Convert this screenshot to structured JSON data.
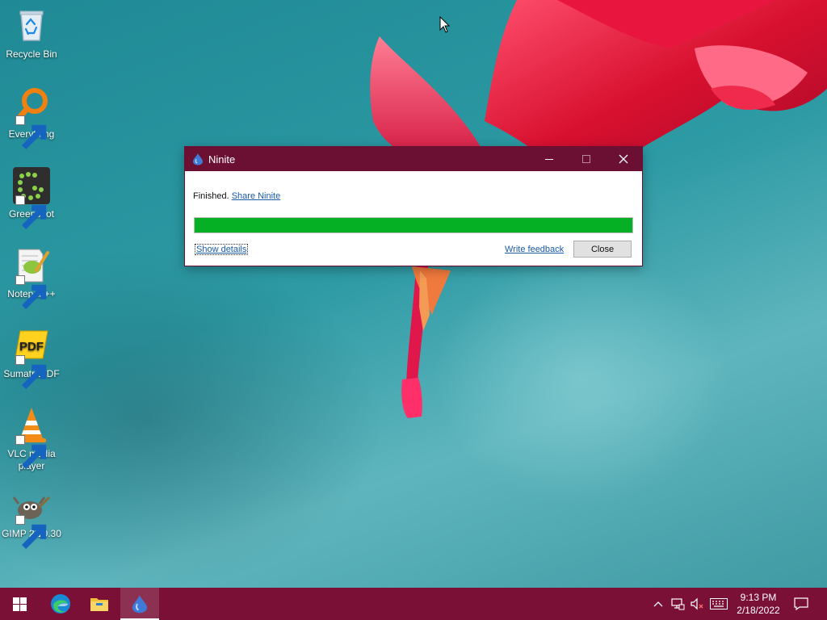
{
  "desktop_icons": [
    {
      "label": "Recycle Bin",
      "icon": "recycle-bin-icon"
    },
    {
      "label": "Everything",
      "icon": "everything-icon"
    },
    {
      "label": "Greenshot",
      "icon": "greenshot-icon"
    },
    {
      "label": "Notepad++",
      "icon": "notepadpp-icon"
    },
    {
      "label": "SumatraPDF",
      "icon": "sumatrapdf-icon",
      "glyph_text": "PDF"
    },
    {
      "label": "VLC media player",
      "icon": "vlc-icon"
    },
    {
      "label": "GIMP 2.10.30",
      "icon": "gimp-icon"
    }
  ],
  "window": {
    "title": "Ninite",
    "status_text": "Finished.",
    "share_link": "Share Ninite",
    "progress": 1.0,
    "progress_color": "#06b025",
    "show_details": "Show details",
    "write_feedback": "Write feedback",
    "close_button": "Close"
  },
  "taskbar": {
    "items": [
      "start-icon",
      "edge-icon",
      "file-explorer-icon",
      "ninite-icon"
    ],
    "tray": {
      "time": "9:13 PM",
      "date": "2/18/2022"
    },
    "color": "#7a1035"
  },
  "colors": {
    "title_bar": "#6b0f33",
    "link": "#1a5aa6"
  }
}
